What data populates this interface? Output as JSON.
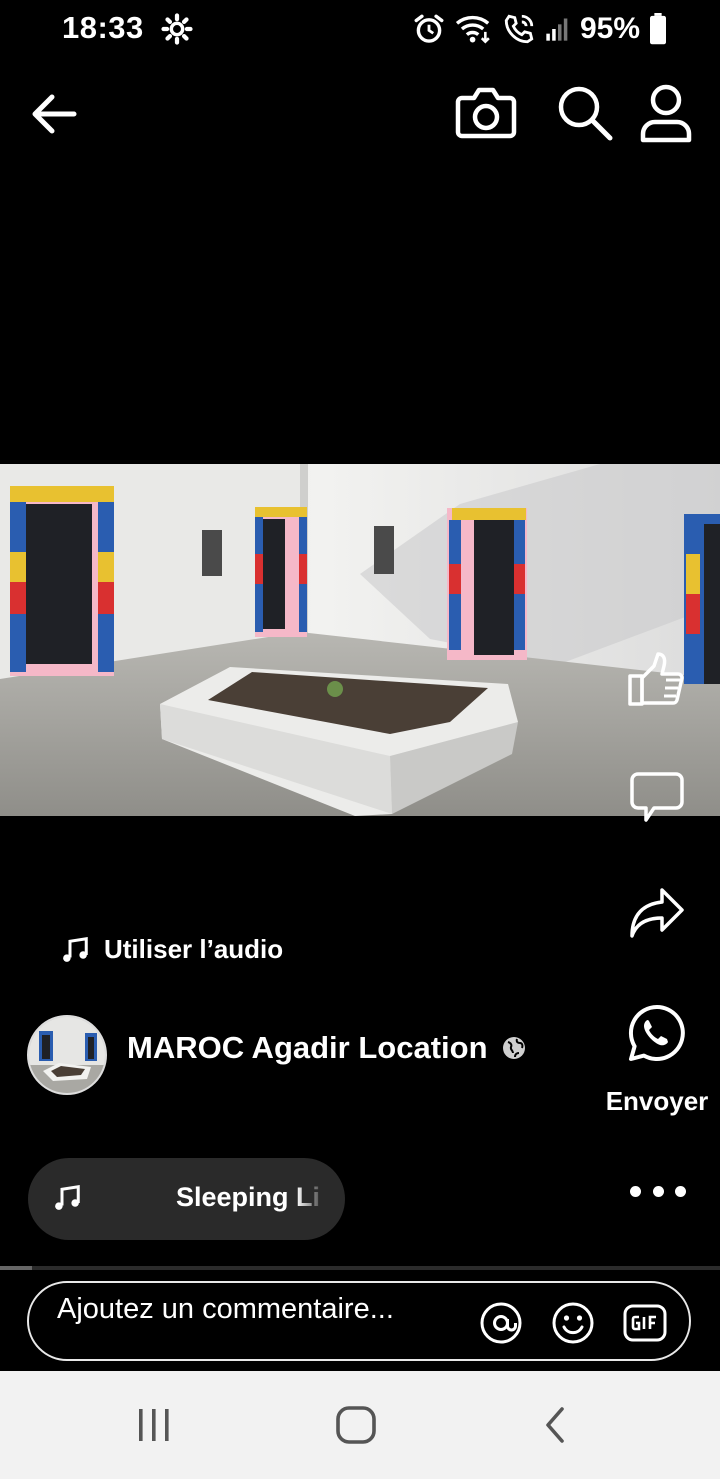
{
  "status_bar": {
    "time": "18:33",
    "battery": "95%",
    "icons": [
      "gear-icon",
      "alarm-icon",
      "wifi-icon",
      "wifi-call-icon",
      "signal-icon",
      "battery-icon"
    ]
  },
  "top_bar": {
    "icons": [
      "back-arrow-icon",
      "camera-icon",
      "search-icon",
      "profile-icon"
    ]
  },
  "post": {
    "audio_label": "Utiliser l’audio",
    "page_name": "MAROC Agadir Location",
    "music_title": "Sleeping Li",
    "progress": 0.045
  },
  "actions": {
    "send_label": "Envoyer",
    "icons": [
      "thumbs-up-icon",
      "comment-icon",
      "share-icon",
      "whatsapp-icon",
      "more-icon"
    ]
  },
  "comment": {
    "placeholder": "Ajoutez un commentaire...",
    "icons": [
      "mention-icon",
      "emoji-icon",
      "gif-icon"
    ]
  },
  "colors": {
    "background": "#000000",
    "nav_bar": "#f2f2f2",
    "pill": "#2a2a2a"
  }
}
